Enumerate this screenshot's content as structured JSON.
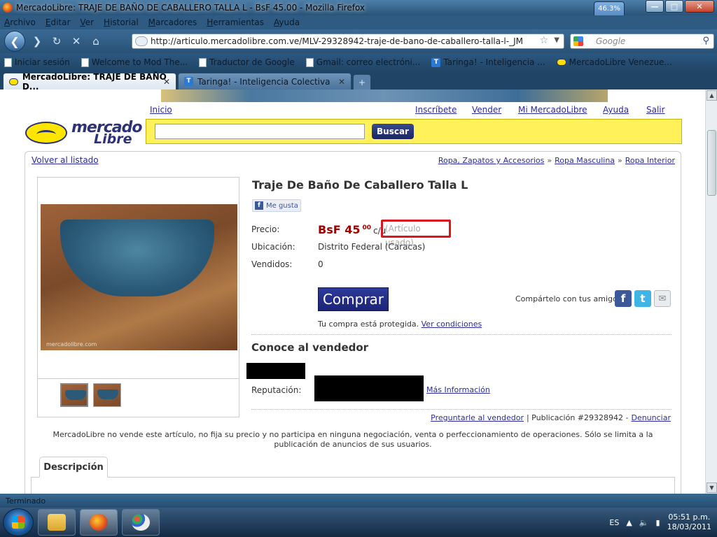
{
  "window": {
    "title": "MercadoLibre: TRAJE DE BAÑO DE CABALLERO TALLA L - BsF 45.00 - Mozilla Firefox",
    "zoom": "46.3%",
    "buttons": {
      "minimize": "—",
      "maximize": "□",
      "close": "✕"
    }
  },
  "menu": [
    "Archivo",
    "Editar",
    "Ver",
    "Historial",
    "Marcadores",
    "Herramientas",
    "Ayuda"
  ],
  "nav": {
    "url": "http://articulo.mercadolibre.com.ve/MLV-29328942-traje-de-bano-de-caballero-talla-l-_JM",
    "search_placeholder": "Google"
  },
  "bookmarks": [
    {
      "label": "Iniciar sesión",
      "icon": "page-icon"
    },
    {
      "label": "Welcome to Mod The...",
      "icon": "page-icon"
    },
    {
      "label": "Traductor de Google",
      "icon": "page-icon"
    },
    {
      "label": "Gmail: correo electróni...",
      "icon": "page-icon"
    },
    {
      "label": "Taringa! - Inteligencia ...",
      "icon": "taringa-icon"
    },
    {
      "label": "MercadoLibre Venezue...",
      "icon": "mercadolibre-icon"
    }
  ],
  "tabs": [
    {
      "label": "MercadoLibre: TRAJE DE BAÑO D...",
      "active": true
    },
    {
      "label": "Taringa! - Inteligencia Colectiva",
      "active": false
    }
  ],
  "site": {
    "top_links": {
      "inicio": "Inicio",
      "inscribete": "Inscríbete",
      "vender": "Vender",
      "mi": "Mi MercadoLibre",
      "ayuda": "Ayuda",
      "salir": "Salir"
    },
    "logo": {
      "line1": "mercado",
      "line2": "Libre"
    },
    "search_button": "Buscar"
  },
  "listing": {
    "back": "Volver al listado",
    "breadcrumbs": [
      "Ropa, Zapatos y Accesorios",
      "Ropa Masculina",
      "Ropa Interior"
    ],
    "breadcrumb_sep": "»",
    "title": "Traje De Baño De Caballero Talla L",
    "like": "Me gusta",
    "labels": {
      "price": "Precio:",
      "location": "Ubicación:",
      "sold": "Vendidos:"
    },
    "price": {
      "amount": "BsF 45",
      "cents": "00",
      "unit": "c/u",
      "condition": "(Artículo usado)"
    },
    "location": "Distrito Federal (Caracas)",
    "sold": "0",
    "buy_button": "Comprar",
    "protected_text": "Tu compra está protegida.",
    "protected_link": "Ver condiciones",
    "share_label": "Compártelo con tus amigos:",
    "seller_heading": "Conoce al vendedor",
    "reputation_label": "Reputación:",
    "more_info": "Más Información",
    "ask_seller": "Preguntarle al vendedor",
    "publication": "| Publicación #29328942 -",
    "report": "Denunciar",
    "disclaimer": "MercadoLibre no vende este artículo, no fija su precio y no participa en ninguna negociación, venta o perfeccionamiento de operaciones. Sólo se limita a la publicación de anuncios de sus usuarios.",
    "description_tab": "Descripción",
    "photo_watermark": "mercadolibre.com"
  },
  "status": "Terminado",
  "taskbar": {
    "apps": [
      "explorer-icon",
      "firefox-icon",
      "paint-icon"
    ],
    "lang": "ES",
    "time": "05:51 p.m.",
    "date": "18/03/2011"
  }
}
